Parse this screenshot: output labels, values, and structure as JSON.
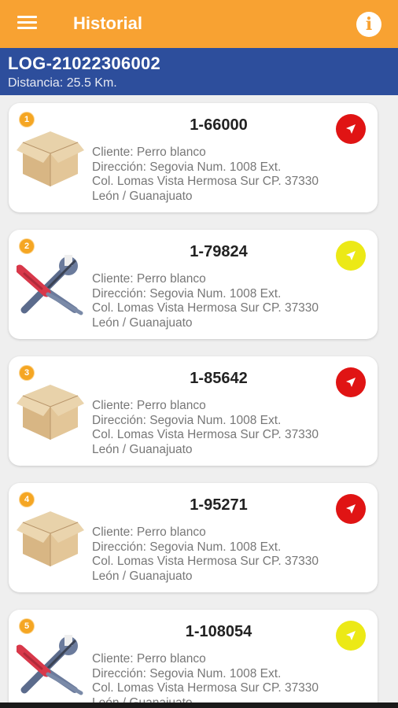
{
  "app_bar": {
    "title": "Historial",
    "menu_icon": "hamburger-menu-icon",
    "info_icon": "info-icon",
    "info_glyph": "i",
    "color": "#f8a232"
  },
  "route": {
    "id": "LOG-21022306002",
    "distance": "Distancia: 25.5 Km.",
    "color": "#2d4e9c"
  },
  "deliveries": [
    {
      "number": "1",
      "code": "1-66000",
      "type": "box-icon",
      "status_color": "#e01414",
      "client": "Cliente: Perro blanco",
      "address": "Dirección: Segovia Num. 1008 Ext.",
      "colony": "Col. Lomas Vista Hermosa Sur  CP. 37330",
      "city": "León / Guanajuato"
    },
    {
      "number": "2",
      "code": "1-79824",
      "type": "tools-icon",
      "status_color": "#ece916",
      "client": "Cliente: Perro blanco",
      "address": "Dirección: Segovia Num. 1008 Ext.",
      "colony": "Col. Lomas Vista Hermosa Sur  CP. 37330",
      "city": "León / Guanajuato"
    },
    {
      "number": "3",
      "code": "1-85642",
      "type": "box-icon",
      "status_color": "#e01414",
      "client": "Cliente: Perro blanco",
      "address": "Dirección: Segovia Num. 1008 Ext.",
      "colony": "Col. Lomas Vista Hermosa Sur  CP. 37330",
      "city": "León / Guanajuato"
    },
    {
      "number": "4",
      "code": "1-95271",
      "type": "box-icon",
      "status_color": "#e01414",
      "client": "Cliente: Perro blanco",
      "address": "Dirección: Segovia Num. 1008 Ext.",
      "colony": "Col. Lomas Vista Hermosa Sur  CP. 37330",
      "city": "León / Guanajuato"
    },
    {
      "number": "5",
      "code": "1-108054",
      "type": "tools-icon",
      "status_color": "#ece916",
      "client": "Cliente: Perro blanco",
      "address": "Dirección: Segovia Num. 1008 Ext.",
      "colony": "Col. Lomas Vista Hermosa Sur  CP. 37330",
      "city": "León / Guanajuato"
    }
  ]
}
